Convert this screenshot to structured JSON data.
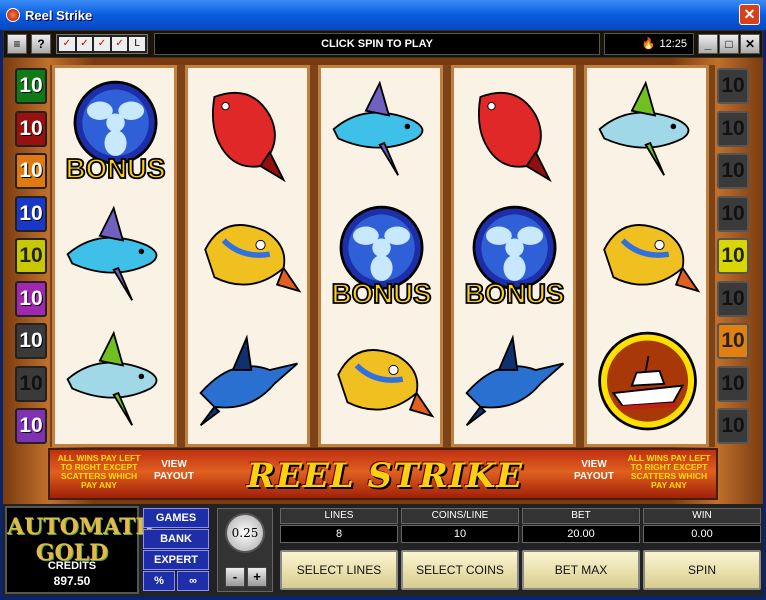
{
  "window": {
    "title": "Reel Strike",
    "close_glyph": "✕"
  },
  "toolbar": {
    "menu_glyph": "≡",
    "help_label": "?",
    "option_glyphs": [
      "✓",
      "✓",
      "✓",
      "✓",
      "L"
    ],
    "message": "CLICK SPIN TO PLAY",
    "time": "12:25",
    "min_glyph": "_",
    "max_glyph": "□",
    "close_glyph": "✕"
  },
  "paylines": {
    "left": [
      "10",
      "10",
      "10",
      "10",
      "10",
      "10",
      "10",
      "10",
      "10"
    ],
    "right": [
      "10",
      "10",
      "10",
      "10",
      "10",
      "10",
      "10",
      "10",
      "10"
    ],
    "left_colors": [
      "#d8d8d8",
      "#0f7a16",
      "#9a1010",
      "#e07a10",
      "#1838c8",
      "#c8c800",
      "#a028b0",
      "#3a3a3a",
      "#0f7a16",
      "#8030b0"
    ],
    "right_highlight": [
      false,
      false,
      false,
      false,
      true,
      false,
      true,
      false,
      false
    ]
  },
  "reels": [
    [
      "bonus",
      "shark",
      "tuna"
    ],
    [
      "red-snapper",
      "mahi",
      "marlin"
    ],
    [
      "shark",
      "bonus",
      "mahi"
    ],
    [
      "red-snapper",
      "bonus",
      "marlin"
    ],
    [
      "tuna",
      "mahi",
      "boat"
    ]
  ],
  "symbols": {
    "bonus_label": "BONUS"
  },
  "banner": {
    "scatter_note": "ALL WINS PAY LEFT TO RIGHT EXCEPT SCATTERS WHICH PAY ANY",
    "view_payout": "VIEW PAYOUT",
    "logo": "REEL STRIKE"
  },
  "panel": {
    "brand": "AUTOMATIC GOLD",
    "credits_label": "CREDITS",
    "credits_value": "897.50",
    "nav": {
      "games": "GAMES",
      "bank": "BANK",
      "expert": "EXPERT",
      "percent": "%",
      "link_glyph": "∞"
    },
    "coin_value": "0.25",
    "coin_minus": "-",
    "coin_plus": "+",
    "lines_label": "LINES",
    "lines_value": "8",
    "coins_label": "COINS/LINE",
    "coins_value": "10",
    "bet_label": "BET",
    "bet_value": "20.00",
    "win_label": "WIN",
    "win_value": "0.00",
    "select_lines": "SELECT LINES",
    "select_coins": "SELECT COINS",
    "bet_max": "BET MAX",
    "spin": "SPIN"
  }
}
